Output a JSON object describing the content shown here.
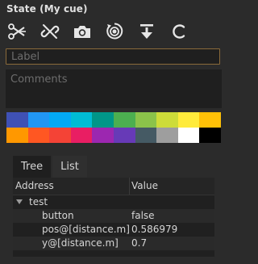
{
  "header": {
    "title": "State (My cue)"
  },
  "toolbar": {
    "tools": [
      {
        "name": "cut-state",
        "icon": "scissors-icon"
      },
      {
        "name": "unlink-state",
        "icon": "broken-link-icon"
      },
      {
        "name": "snapshot",
        "icon": "camera-icon"
      },
      {
        "name": "record",
        "icon": "record-circle-icon"
      },
      {
        "name": "push-down",
        "icon": "arrow-down-bar-icon"
      },
      {
        "name": "refresh",
        "icon": "refresh-c-icon"
      }
    ]
  },
  "label_field": {
    "placeholder": "Label",
    "value": "",
    "border_color": "#8a6a3a"
  },
  "comments_field": {
    "placeholder": "Comments",
    "value": ""
  },
  "palette": {
    "colors": [
      "#3f51b5",
      "#2196f3",
      "#03a9f4",
      "#00bcd4",
      "#009688",
      "#4caf50",
      "#8bc34a",
      "#cddc39",
      "#ffeb3b",
      "#ffc107",
      "#ff9800",
      "#ff5722",
      "#f44336",
      "#e91e63",
      "#9c27b0",
      "#673ab7",
      "#455a64",
      "#9e9e9e",
      "#ffffff",
      "#000000"
    ]
  },
  "tabs": [
    {
      "label": "Tree",
      "active": true
    },
    {
      "label": "List",
      "active": false
    }
  ],
  "tree": {
    "headers": {
      "address": "Address",
      "value": "Value"
    },
    "rows": [
      {
        "address": "test",
        "value": "",
        "expanded": true,
        "depth": 0
      },
      {
        "address": "button",
        "value": "false",
        "depth": 1
      },
      {
        "address": "pos@[distance.m]",
        "value": "0.586979",
        "depth": 1
      },
      {
        "address": "y@[distance.m]",
        "value": "0.7",
        "depth": 1
      }
    ]
  }
}
